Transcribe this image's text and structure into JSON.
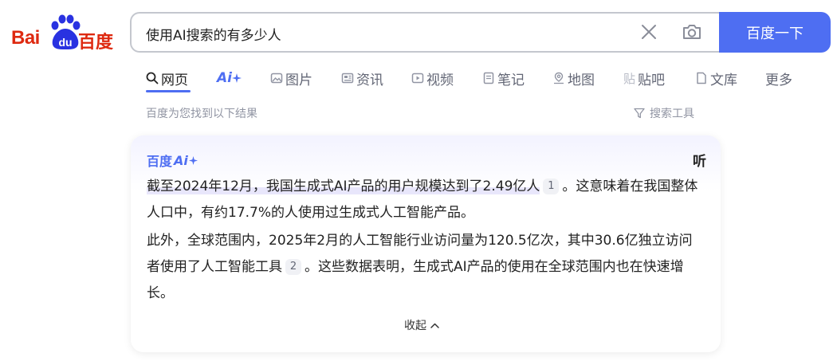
{
  "logo": {
    "bai": "Bai",
    "du": "du",
    "chinese": "百度"
  },
  "search": {
    "query": "使用AI搜索的有多少人",
    "button_label": "百度一下"
  },
  "tabs": [
    {
      "label": "网页",
      "icon": "search-icon",
      "active": true
    },
    {
      "label": "Ai",
      "icon": "ai-sparkle-icon"
    },
    {
      "label": "图片",
      "icon": "image-icon"
    },
    {
      "label": "资讯",
      "icon": "news-icon"
    },
    {
      "label": "视频",
      "icon": "video-icon"
    },
    {
      "label": "笔记",
      "icon": "note-icon"
    },
    {
      "label": "地图",
      "icon": "map-icon"
    },
    {
      "label": "贴吧",
      "icon": "tieba-icon"
    },
    {
      "label": "文库",
      "icon": "doc-icon"
    },
    {
      "label": "更多",
      "icon": ""
    }
  ],
  "results": {
    "summary": "百度为您找到以下结果",
    "tools_label": "搜索工具"
  },
  "ai_card": {
    "brand_prefix": "百度",
    "brand_ai": "Ai",
    "listen_label": "听",
    "para1_highlight": "截至2024年12月，我国生成式AI产品的用户规模达到了2.49亿人",
    "para1_cite": "1",
    "para1_rest": "。这意味着在我国整体人口中，有约17.7%的人使用过生成式人工智能产品。",
    "para2_start": "此外，全球范围内，2025年2月的人工智能行业访问量为120.5亿次，其中30.6亿独立访问者使用了人工智能工具",
    "para2_cite": "2",
    "para2_rest": "。这些数据表明，生成式AI产品的使用在全球范围内也在快速增长。",
    "collapse_label": "收起"
  },
  "colors": {
    "brand_red": "#de2910",
    "brand_blue": "#4e6ef2",
    "muted_text": "#9195a3"
  }
}
